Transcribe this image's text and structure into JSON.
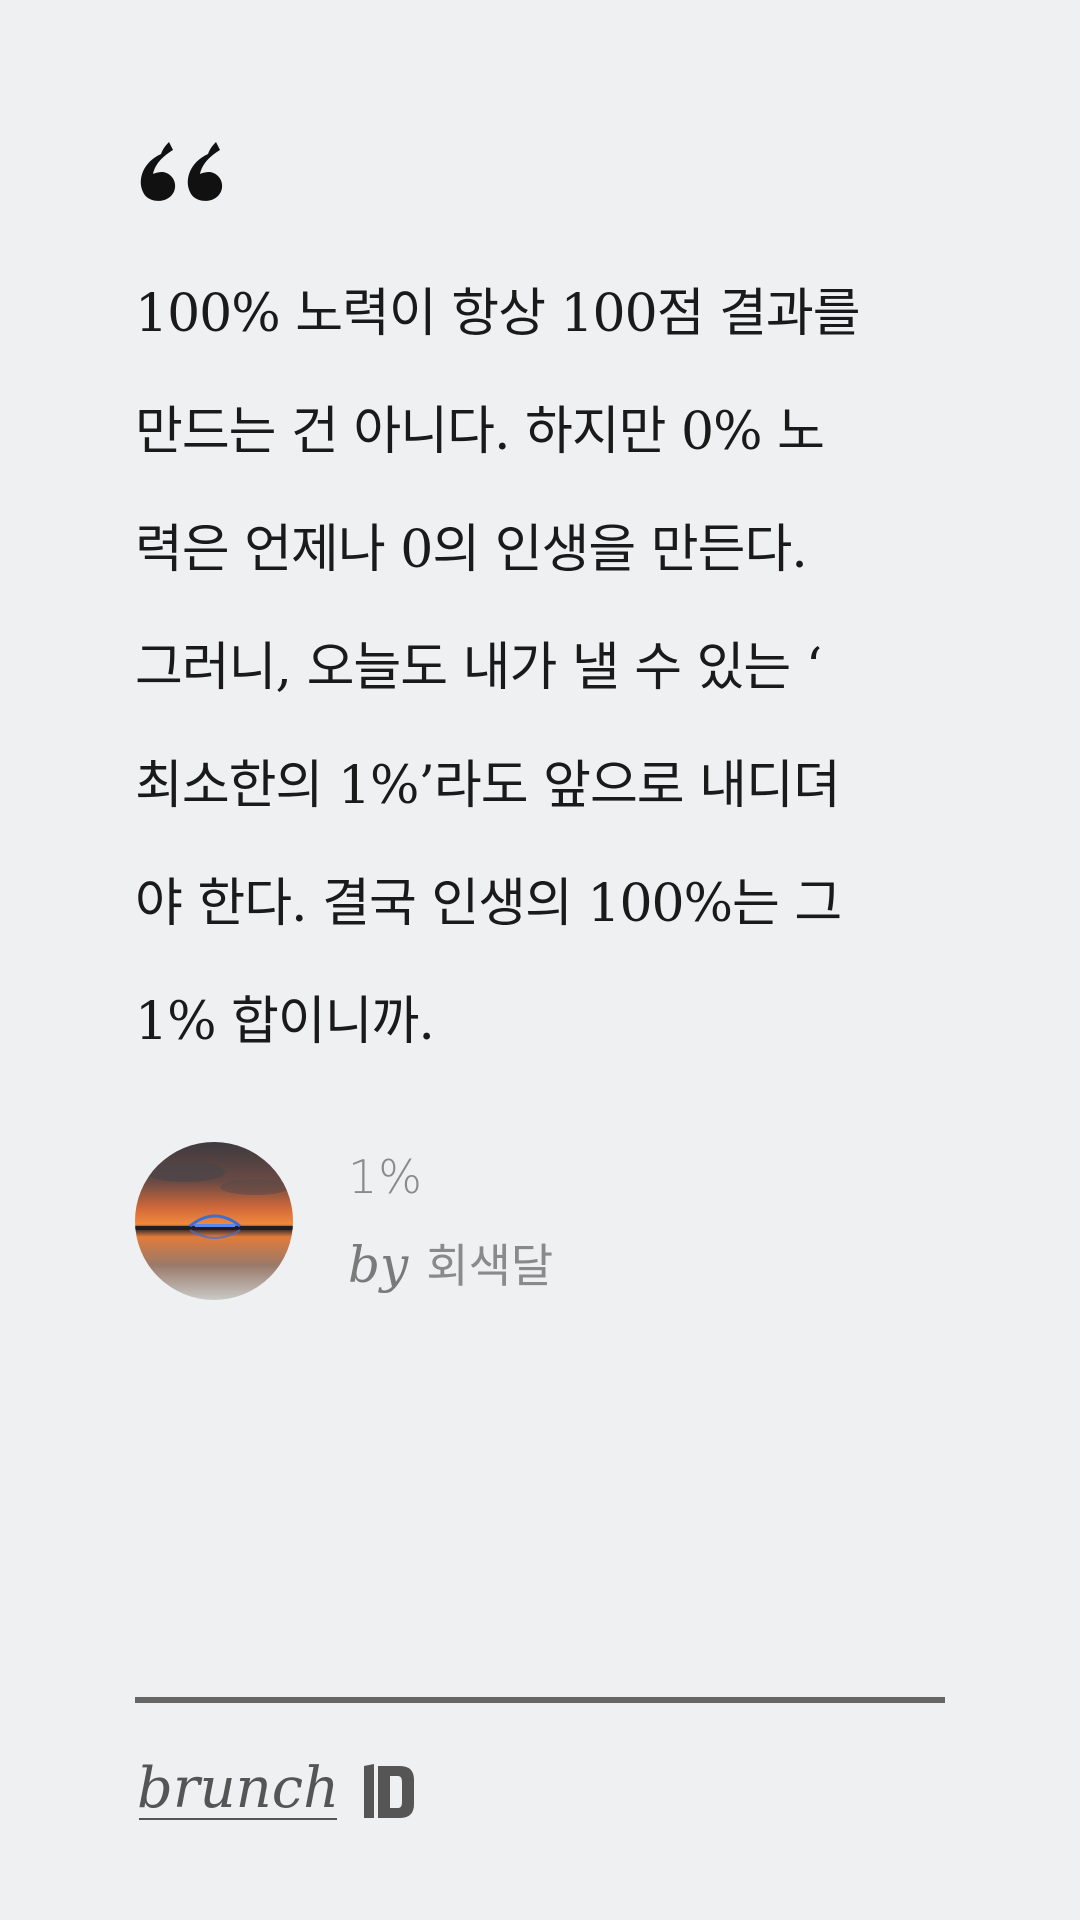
{
  "quote": {
    "icon": "quote-open-icon",
    "lines": [
      "100% 노력이 항상 100점 결과를",
      "만드는 건 아니다. 하지만 0% 노",
      "력은 언제나 0의 인생을 만든다.",
      "그러니, 오늘도 내가 낼 수 있는 ‘",
      "최소한의 1%’라도 앞으로 내디뎌",
      "야 한다. 결국 인생의 100%는 그",
      "1% 합이니까."
    ]
  },
  "author": {
    "avatar_icon": "sunset-bridge-avatar",
    "work_title": "1%",
    "by_label": "by",
    "name": "회색달"
  },
  "footer": {
    "brand_text": "brunch",
    "brand_mark_icon": "brunch-b-icon"
  },
  "colors": {
    "background": "#eff0f2",
    "text": "#1a1a1a",
    "muted": "#8a8a8a",
    "divider": "#666666"
  }
}
